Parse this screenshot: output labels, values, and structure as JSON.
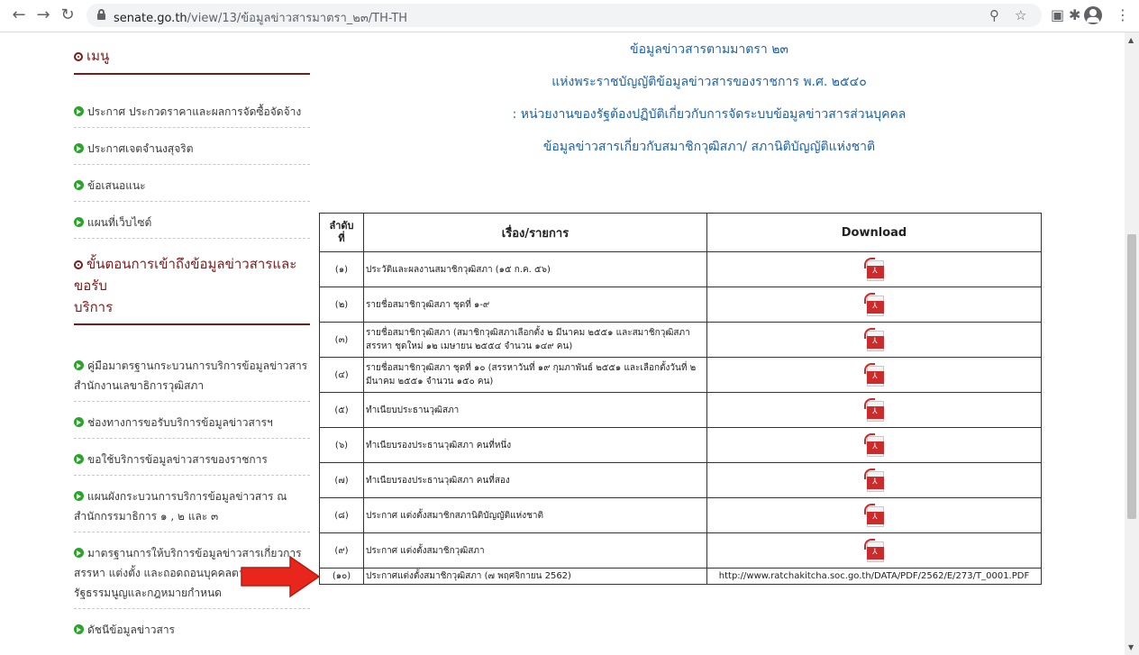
{
  "browser": {
    "url_host": "senate.go.th",
    "url_path": "/view/13/ข้อมูลข่าวสารมาตรา_๒๓/TH-TH"
  },
  "sidebar": {
    "menu_title": "เมนู",
    "items": [
      "ประกาศ ประกวดราคาและผลการจัดซื้อจัดจ้าง",
      "ประกาศเจตจำนงสุจริต",
      "ข้อเสนอแนะ",
      "แผนที่เว็บไซต์"
    ],
    "section_title_line1": "ขั้นตอนการเข้าถึงข้อมูลข่าวสารและขอรับ",
    "section_title_line2": "บริการ",
    "section_items": [
      {
        "line1": "คู่มือมาตรฐานกระบวนการบริการข้อมูลข่าวสาร",
        "line2": "สำนักงานเลขาธิการวุฒิสภา"
      },
      {
        "line1": "ช่องทางการขอรับบริการข้อมูลข่าวสารฯ",
        "line2": ""
      },
      {
        "line1": "ขอใช้บริการข้อมูลข่าวสารของราชการ",
        "line2": ""
      },
      {
        "line1": "แผนผังกระบวนการบริการข้อมูลข่าวสาร ณ",
        "line2": "สำนักกรรมาธิการ ๑ , ๒ และ ๓"
      },
      {
        "line1": "มาตรฐานการให้บริการข้อมูลข่าวสารเกี่ยวการ",
        "line2": "สรรหา แต่งตั้ง และถอดถอนบุคคลตาม",
        "line3": "รัฐธรรมนูญและกฎหมายกำหนด"
      },
      {
        "line1": "ดัชนีข้อมูลข่าวสาร",
        "line2": ""
      }
    ]
  },
  "main": {
    "headings": [
      "ข้อมูลข่าวสารตามมาตรา ๒๓",
      "แห่งพระราชบัญญัติข้อมูลข่าวสารของราชการ พ.ศ. ๒๕๔๐",
      ": หน่วยงานของรัฐต้องปฏิบัติเกี่ยวกับการจัดระบบข้อมูลข่าวสารส่วนบุคคล",
      "ข้อมูลข่าวสารเกี่ยวกับสมาชิกวุฒิสภา/ สภานิติบัญญัติแห่งชาติ"
    ],
    "table": {
      "col_seq_line1": "ลำดับ",
      "col_seq_line2": "ที่",
      "col_title": "เรื่อง/รายการ",
      "col_download": "Download",
      "rows": [
        {
          "num": "(๑)",
          "title": "ประวัติและผลงานสมาชิกวุฒิสภา (๑๕ ก.ค. ๕๖)",
          "download": ""
        },
        {
          "num": "(๒)",
          "title": "รายชื่อสมาชิกวุฒิสภา ชุดที่ ๑-๙",
          "download": ""
        },
        {
          "num": "(๓)",
          "title": "รายชื่อสมาชิกวุฒิสภา (สมาชิกวุฒิสภาเลือกตั้ง ๒ มีนาคม ๒๕๕๑ และสมาชิกวุฒิสภาสรรหา ชุดใหม่ ๑๒ เมษายน ๒๕๕๔ จำนวน ๑๔๙ คน)",
          "download": ""
        },
        {
          "num": "(๔)",
          "title": "รายชื่อสมาชิกวุฒิสภา ชุดที่ ๑๐ (สรรหาวันที่ ๑๙ กุมภาพันธ์ ๒๕๕๑ และเลือกตั้งวันที่ ๒ มีนาคม ๒๕๕๑ จำนวน ๑๕๐ คน)",
          "download": ""
        },
        {
          "num": "(๕)",
          "title": "ทำเนียบประธานวุฒิสภา",
          "download": ""
        },
        {
          "num": "(๖)",
          "title": "ทำเนียบรองประธานวุฒิสภา คนที่หนึ่ง",
          "download": ""
        },
        {
          "num": "(๗)",
          "title": "ทำเนียบรองประธานวุฒิสภา คนที่สอง",
          "download": ""
        },
        {
          "num": "(๘)",
          "title": "ประกาศ แต่งตั้งสมาชิกสภานิติบัญญัติแห่งชาติ",
          "download": ""
        },
        {
          "num": "(๙)",
          "title": "ประกาศ แต่งตั้งสมาชิกวุฒิสภา",
          "download": ""
        },
        {
          "num": "(๑๐)",
          "title": "ประกาศแต่งตั้งสมาชิกวุฒิสภา (๗ พฤศจิกายน 2562)",
          "download": "http://www.ratchakitcha.soc.go.th/DATA/PDF/2562/E/273/T_0001.PDF"
        }
      ]
    }
  },
  "colors": {
    "heading_blue": "#1d62a8",
    "menu_maroon": "#7a1b1b",
    "bullet_green": "#2aa52a",
    "arrow_red": "#e8261b"
  }
}
